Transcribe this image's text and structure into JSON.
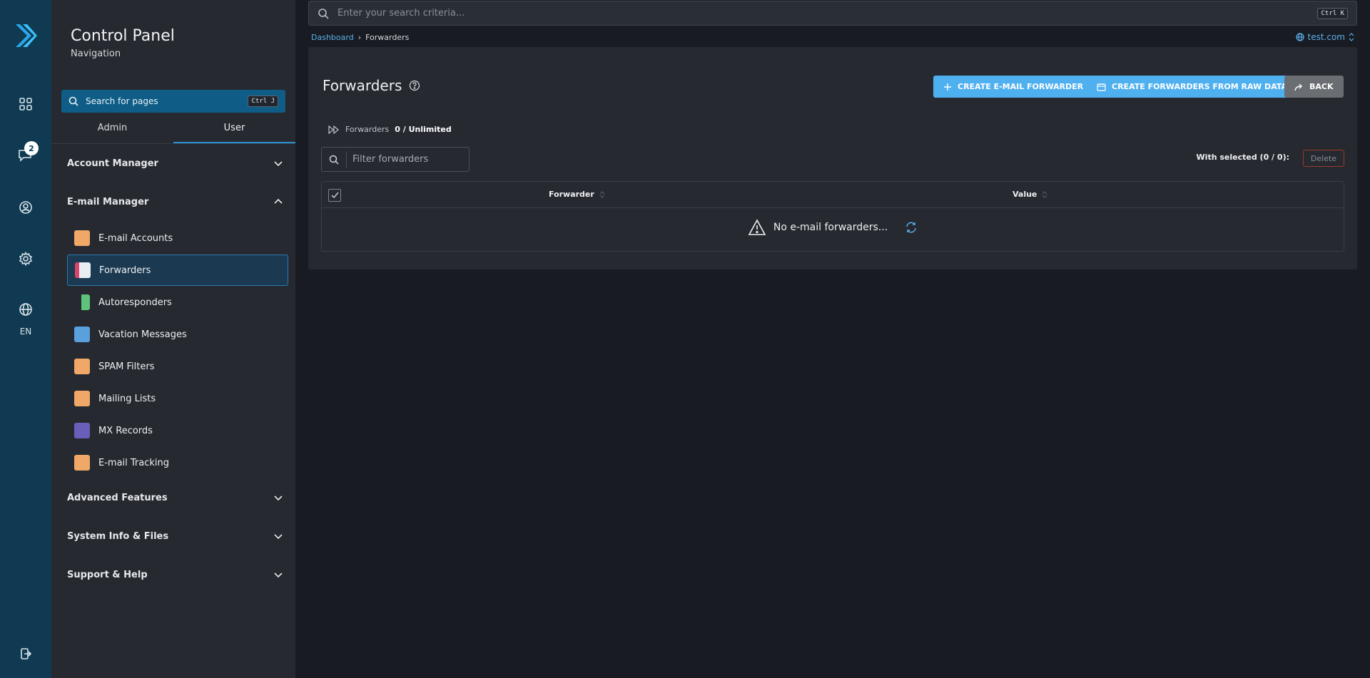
{
  "rail": {
    "badge_count": "2",
    "language": "EN",
    "icons": [
      "logo-icon",
      "dashboard-icon",
      "messages-icon",
      "user-icon",
      "settings-icon",
      "globe-icon",
      "logout-icon"
    ]
  },
  "sidebar": {
    "title": "Control Panel",
    "subtitle": "Navigation",
    "search": {
      "placeholder": "Search for pages",
      "shortcut": "Ctrl J"
    },
    "tabs": [
      {
        "label": "Admin"
      },
      {
        "label": "User",
        "active": true
      }
    ],
    "sections": [
      {
        "label": "Account Manager",
        "expanded": false
      },
      {
        "label": "E-mail Manager",
        "expanded": true
      },
      {
        "label": "Advanced Features",
        "expanded": false
      },
      {
        "label": "System Info & Files",
        "expanded": false
      },
      {
        "label": "Support & Help",
        "expanded": false
      }
    ],
    "email_items": [
      {
        "label": "E-mail Accounts",
        "icon": "email-accounts-icon"
      },
      {
        "label": "Forwarders",
        "icon": "forwarders-icon",
        "selected": true
      },
      {
        "label": "Autoresponders",
        "icon": "autoresponders-icon"
      },
      {
        "label": "Vacation Messages",
        "icon": "vacation-messages-icon"
      },
      {
        "label": "SPAM Filters",
        "icon": "spam-filters-icon"
      },
      {
        "label": "Mailing Lists",
        "icon": "mailing-lists-icon"
      },
      {
        "label": "MX Records",
        "icon": "mx-records-icon"
      },
      {
        "label": "E-mail Tracking",
        "icon": "email-tracking-icon"
      }
    ]
  },
  "topbar": {
    "search_placeholder": "Enter your search criteria...",
    "shortcut": "Ctrl K"
  },
  "breadcrumb": {
    "root": "Dashboard",
    "current": "Forwarders"
  },
  "domain": "test.com",
  "main": {
    "title": "Forwarders",
    "buttons": {
      "create": "CREATE E-MAIL FORWARDER",
      "raw": "CREATE FORWARDERS FROM RAW DATA",
      "back": "BACK"
    },
    "stat_label": "Forwarders",
    "stat_value": "0 / Unlimited",
    "filter_placeholder": "Filter forwarders",
    "with_selected": "With selected (0 / 0):",
    "delete": "Delete",
    "columns": [
      "Forwarder",
      "Value"
    ],
    "empty_text": "No e-mail forwarders..."
  },
  "colors": {
    "rail": "#0f3a52",
    "sidebar": "#262930",
    "background": "#181b22",
    "accent": "#4fb0f0",
    "search": "#0f5d86"
  }
}
